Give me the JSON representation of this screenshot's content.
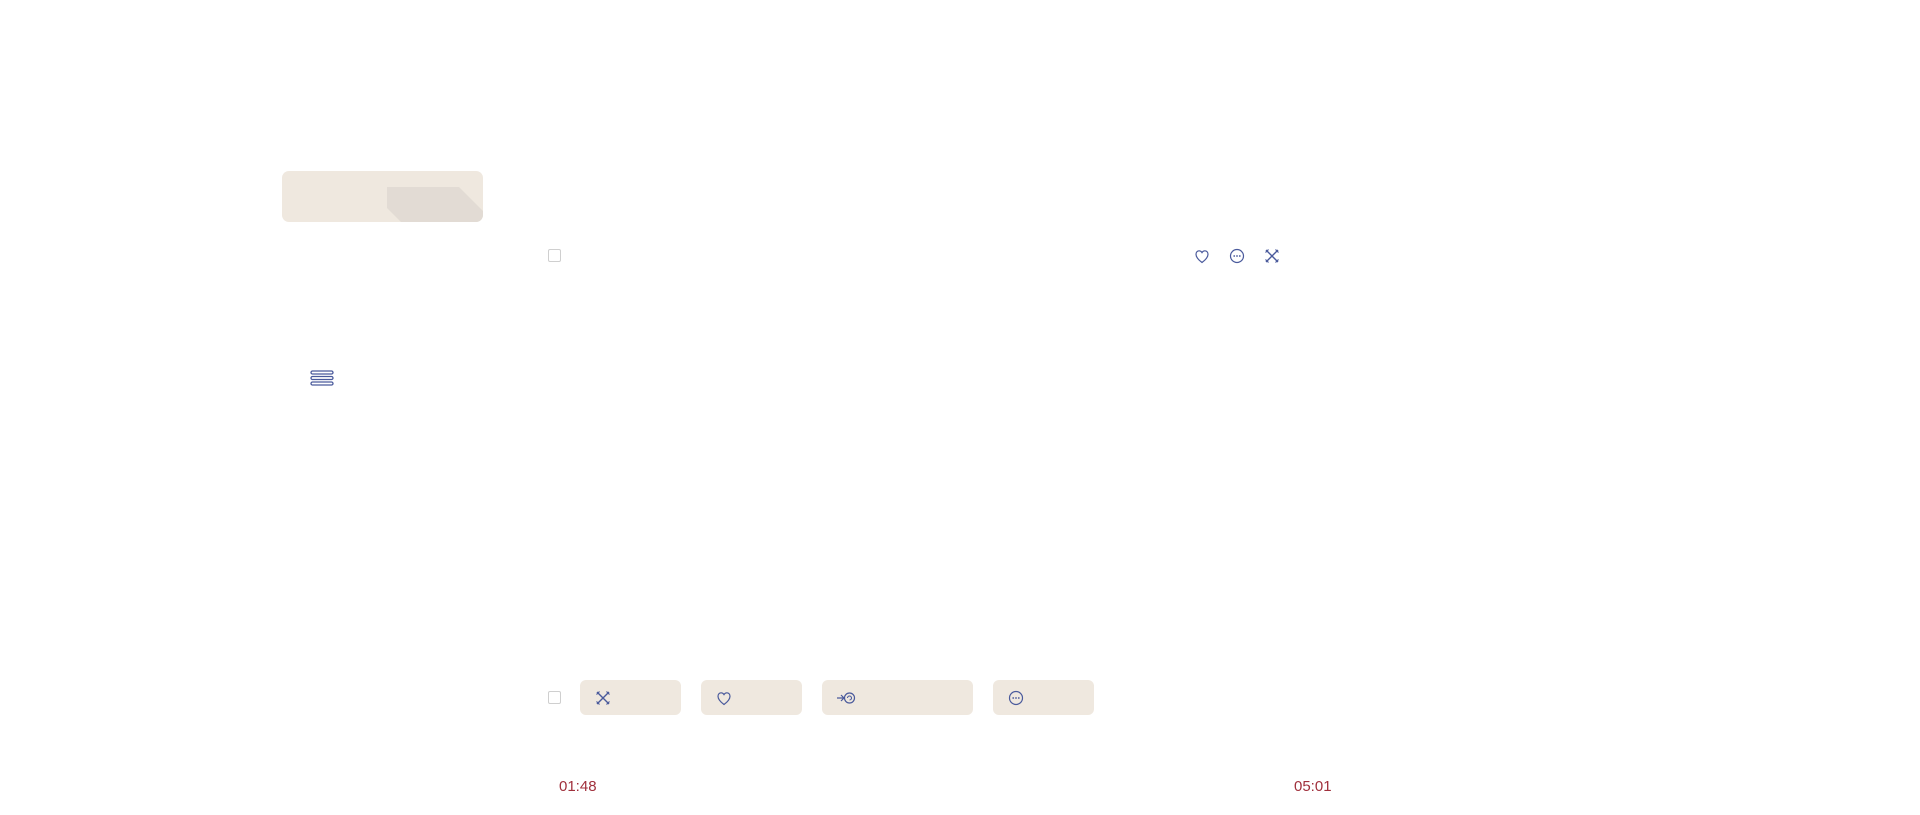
{
  "colors": {
    "accent_icon": "#4a5a9c",
    "chip_background": "#efe8df",
    "placeholder_shape": "#e2dbd4",
    "time_text": "#a0303c",
    "checkbox_border": "#cfcfcf"
  },
  "header_card": {
    "icon": "folded-document-placeholder"
  },
  "menu": {
    "icon": "hamburger-icon"
  },
  "top_row": {
    "actions": [
      {
        "name": "favorite",
        "icon": "heart-icon"
      },
      {
        "name": "more",
        "icon": "more-icon"
      },
      {
        "name": "tools",
        "icon": "tools-icon"
      }
    ]
  },
  "bottom_row": {
    "chips": [
      {
        "name": "tools",
        "icon": "tools-icon",
        "label": ""
      },
      {
        "name": "favorite",
        "icon": "heart-icon",
        "label": ""
      },
      {
        "name": "share",
        "icon": "share-icon",
        "label": ""
      },
      {
        "name": "more",
        "icon": "more-icon",
        "label": ""
      }
    ]
  },
  "timeline": {
    "start_time": "01:48",
    "end_time": "05:01"
  }
}
